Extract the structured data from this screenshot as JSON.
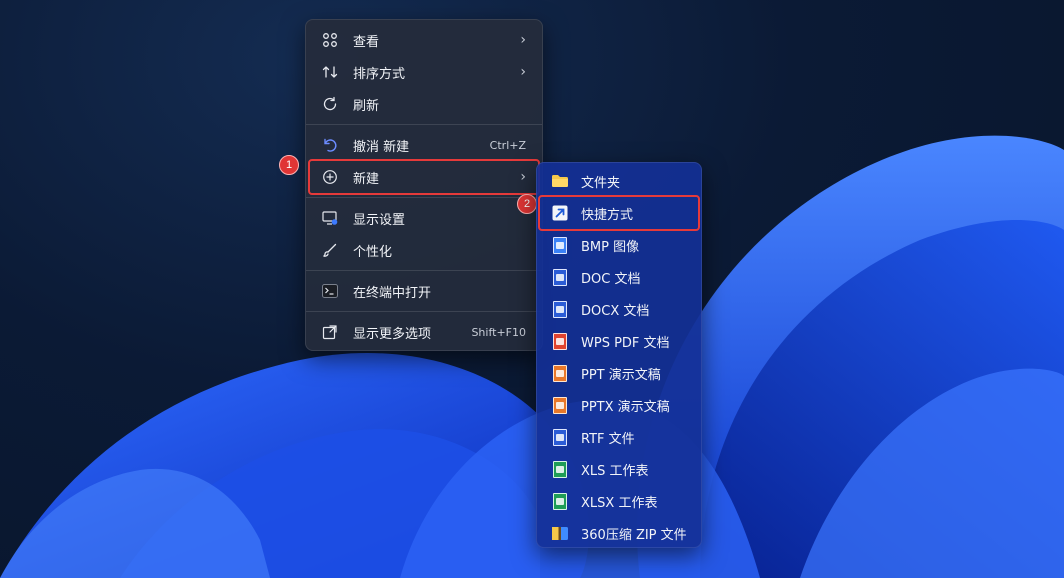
{
  "colors": {
    "highlight": "#e63a3a",
    "badge": "#e03535",
    "menu_bg": "#242c3c",
    "submenu_bg": "#14309a"
  },
  "main_menu": {
    "items": [
      {
        "label": "查看",
        "icon": "grid-icon",
        "arrow": "›"
      },
      {
        "label": "排序方式",
        "icon": "sort-icon",
        "arrow": "›"
      },
      {
        "label": "刷新",
        "icon": "refresh-icon"
      },
      {
        "label": "撤消 新建",
        "icon": "undo-icon",
        "shortcut": "Ctrl+Z"
      },
      {
        "label": "新建",
        "icon": "new-plus-icon",
        "arrow": "›"
      },
      {
        "label": "显示设置",
        "icon": "display-settings-icon"
      },
      {
        "label": "个性化",
        "icon": "brush-icon"
      },
      {
        "label": "在终端中打开",
        "icon": "terminal-icon"
      },
      {
        "label": "显示更多选项",
        "icon": "more-options-icon",
        "shortcut": "Shift+F10"
      }
    ]
  },
  "submenu": {
    "items": [
      {
        "label": "文件夹",
        "icon": "folder-icon"
      },
      {
        "label": "快捷方式",
        "icon": "shortcut-icon"
      },
      {
        "label": "BMP 图像",
        "icon": "bmp-file-icon"
      },
      {
        "label": "DOC 文档",
        "icon": "doc-file-icon"
      },
      {
        "label": "DOCX 文档",
        "icon": "docx-file-icon"
      },
      {
        "label": "WPS PDF 文档",
        "icon": "pdf-file-icon"
      },
      {
        "label": "PPT 演示文稿",
        "icon": "ppt-file-icon"
      },
      {
        "label": "PPTX 演示文稿",
        "icon": "pptx-file-icon"
      },
      {
        "label": "RTF 文件",
        "icon": "rtf-file-icon"
      },
      {
        "label": "XLS 工作表",
        "icon": "xls-file-icon"
      },
      {
        "label": "XLSX 工作表",
        "icon": "xlsx-file-icon"
      },
      {
        "label": "360压缩 ZIP 文件",
        "icon": "zip-file-icon"
      }
    ]
  },
  "badges": {
    "step1": "1",
    "step2": "2"
  }
}
